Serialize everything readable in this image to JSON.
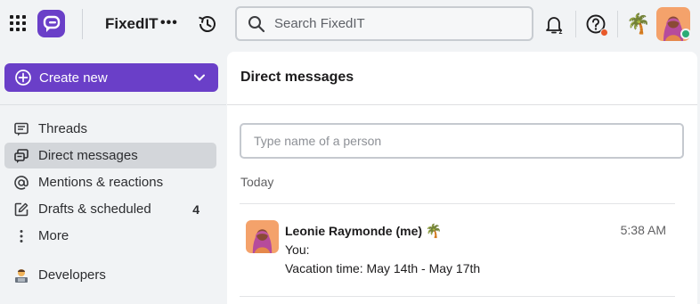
{
  "topbar": {
    "workspace_name": "FixedIT",
    "more_label": "•••",
    "search_placeholder": "Search FixedIT",
    "status_emoji": "🌴",
    "accent_color": "#6a3fc8",
    "icons": [
      "apps-grid-icon",
      "app-logo-icon",
      "history-icon",
      "search-icon",
      "snooze-bell-icon",
      "help-icon",
      "avatar"
    ]
  },
  "sidebar": {
    "create_label": "Create new",
    "items": [
      {
        "label": "Threads",
        "icon": "threads-icon"
      },
      {
        "label": "Direct messages",
        "icon": "direct-messages-icon",
        "active": true
      },
      {
        "label": "Mentions & reactions",
        "icon": "at-mention-icon"
      },
      {
        "label": "Drafts & scheduled",
        "icon": "drafts-icon",
        "count": "4"
      },
      {
        "label": "More",
        "icon": "more-vertical-icon"
      },
      {
        "label": "Developers",
        "icon": "developer-emoji-icon"
      }
    ]
  },
  "main": {
    "title": "Direct messages",
    "search_placeholder": "Type name of a person",
    "day_label": "Today",
    "messages": [
      {
        "sender": "Leonie Raymonde (me)",
        "emoji": "🌴",
        "time": "5:38 AM",
        "line1": "You:",
        "line2": "Vacation time: May 14th - May 17th"
      }
    ]
  }
}
